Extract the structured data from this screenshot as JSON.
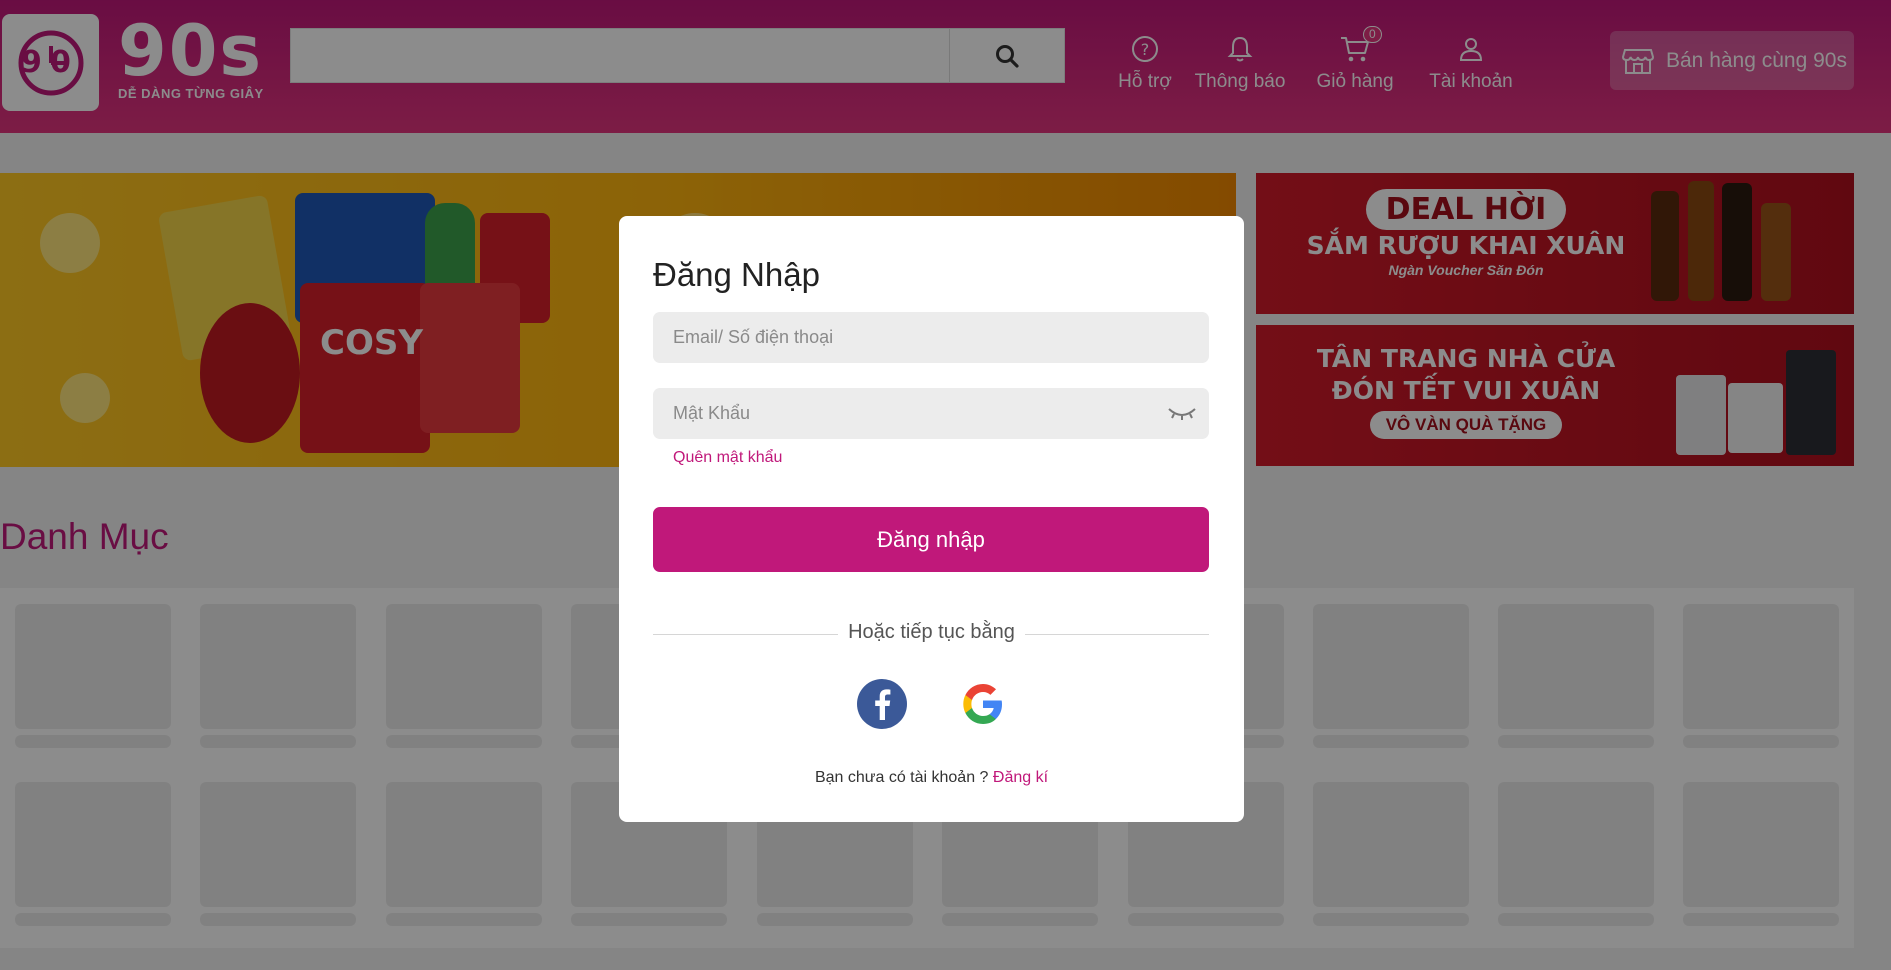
{
  "header": {
    "logo_text": "90s",
    "logo_tagline": "DỄ DÀNG TỪNG GIÂY",
    "search": {
      "placeholder": "",
      "value": ""
    },
    "nav": [
      {
        "label": "Hỗ trợ",
        "icon": "help-circle-icon"
      },
      {
        "label": "Thông báo",
        "icon": "bell-icon"
      },
      {
        "label": "Giỏ hàng",
        "icon": "cart-icon",
        "badge": "0"
      },
      {
        "label": "Tài khoản",
        "icon": "user-icon"
      }
    ],
    "sell_button": {
      "label": "Bán hàng cùng 90s",
      "icon": "store-icon"
    }
  },
  "banners": {
    "side_top": {
      "pill": "DEAL HỜI",
      "title": "SẮM RƯỢU KHAI XUÂN",
      "small": "Ngàn Voucher Săn Đón"
    },
    "side_bottom": {
      "line1": "TÂN TRANG NHÀ CỬA",
      "line2": "ĐÓN TẾT VUI XUÂN",
      "pill": "VÔ VÀN QUÀ TẶNG"
    },
    "main": {
      "brand": "COSY"
    }
  },
  "category": {
    "title": "Danh Mục"
  },
  "login_modal": {
    "title": "Đăng Nhập",
    "email_placeholder": "Email/ Số điện thoại",
    "password_placeholder": "Mật Khẩu",
    "forgot_password": "Quên mật khẩu",
    "login_button": "Đăng nhập",
    "or_continue": "Hoặc tiếp tục bằng",
    "social": [
      {
        "name": "facebook",
        "icon": "facebook-icon",
        "color": "#3b5998"
      },
      {
        "name": "google",
        "icon": "google-icon"
      }
    ],
    "no_account": "Bạn chưa có tài khoản ?",
    "signup_link": "Đăng kí"
  },
  "colors": {
    "brand": "#c0187a",
    "header_gradient_end": "#e3357f",
    "overlay": "rgba(0,0,0,0.45)"
  }
}
